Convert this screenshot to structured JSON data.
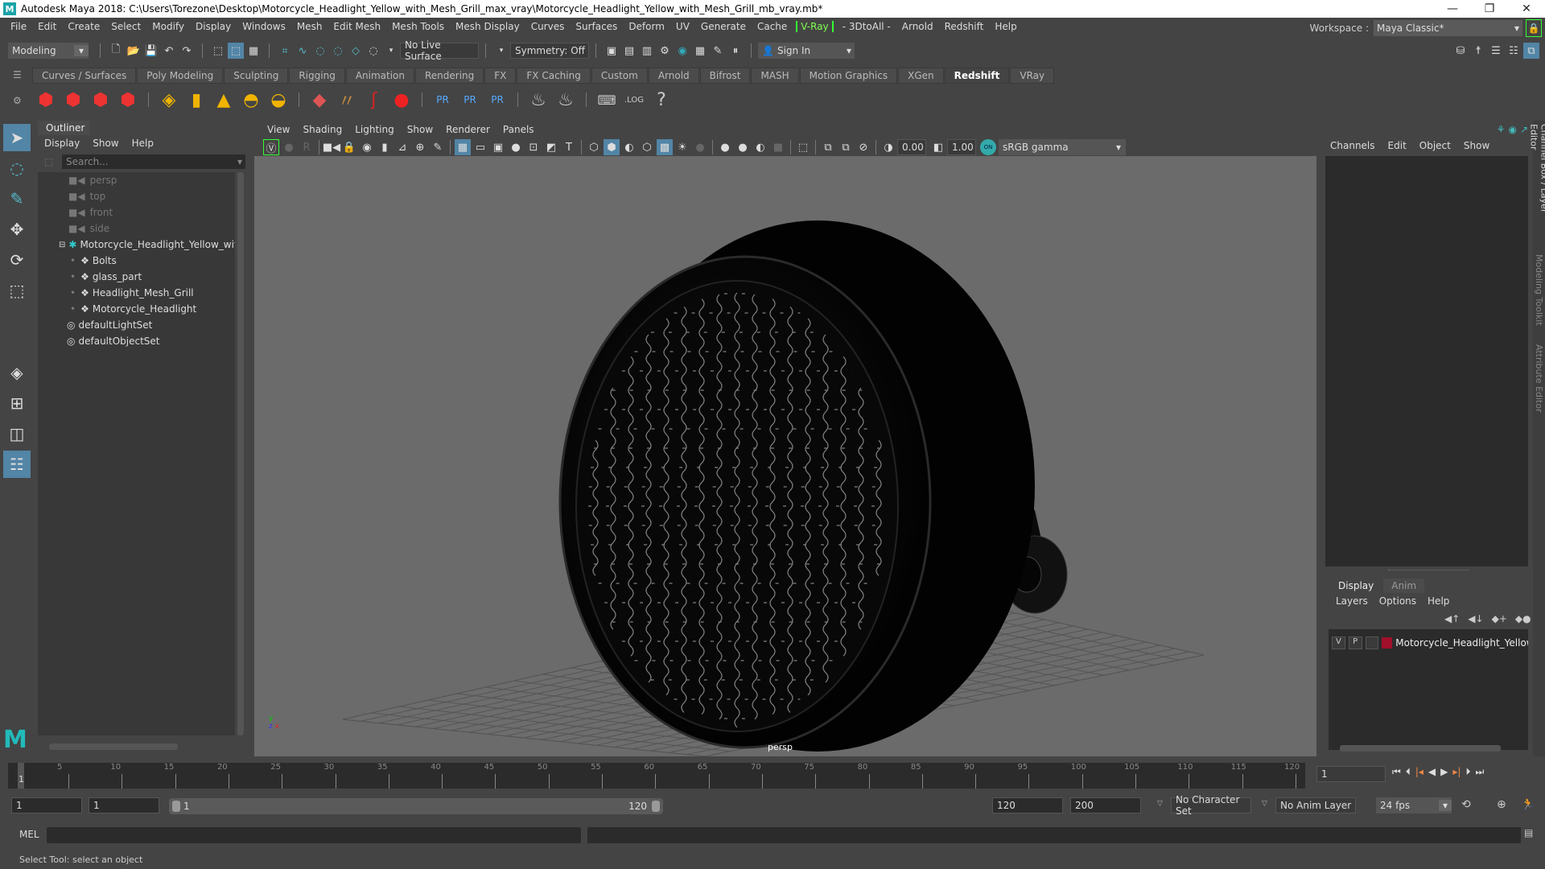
{
  "titlebar": {
    "title": "Autodesk Maya 2018: C:\\Users\\Torezone\\Desktop\\Motorcycle_Headlight_Yellow_with_Mesh_Grill_max_vray\\Motorcycle_Headlight_Yellow_with_Mesh_Grill_mb_vray.mb*",
    "logo": "M",
    "minimize": "—",
    "restore": "❐",
    "close": "✕"
  },
  "menubar": {
    "items": [
      "File",
      "Edit",
      "Create",
      "Select",
      "Modify",
      "Display",
      "Windows",
      "Mesh",
      "Edit Mesh",
      "Mesh Tools",
      "Mesh Display",
      "Curves",
      "Surfaces",
      "Deform",
      "UV",
      "Generate",
      "Cache"
    ],
    "vray": "V-Ray",
    "extra": [
      "- 3DtoAll -",
      "Arnold",
      "Redshift",
      "Help"
    ]
  },
  "workspace": {
    "label": "Workspace :",
    "value": "Maya Classic*"
  },
  "statusline": {
    "mode": "Modeling",
    "live_surface": "No Live Surface",
    "symmetry": "Symmetry: Off",
    "sign_in": "Sign In"
  },
  "shelf": {
    "tabs": [
      "Curves / Surfaces",
      "Poly Modeling",
      "Sculpting",
      "Rigging",
      "Animation",
      "Rendering",
      "FX",
      "FX Caching",
      "Custom",
      "Arnold",
      "Bifrost",
      "MASH",
      "Motion Graphics",
      "XGen",
      "Redshift",
      "VRay"
    ],
    "active_tab": "Redshift",
    "icons": {
      "rv": "RV",
      "ipr": "IPR",
      "pr": "PR",
      "log": ".LOG",
      "help": "?"
    }
  },
  "outliner": {
    "title": "Outliner",
    "menu": [
      "Display",
      "Show",
      "Help"
    ],
    "search_placeholder": "Search...",
    "items": [
      {
        "label": "persp",
        "type": "camera",
        "dim": true
      },
      {
        "label": "top",
        "type": "camera",
        "dim": true
      },
      {
        "label": "front",
        "type": "camera",
        "dim": true
      },
      {
        "label": "side",
        "type": "camera",
        "dim": true
      },
      {
        "label": "Motorcycle_Headlight_Yellow_with_M",
        "type": "group",
        "expanded": true
      },
      {
        "label": "Bolts",
        "type": "mesh",
        "child": true
      },
      {
        "label": "glass_part",
        "type": "mesh",
        "child": true
      },
      {
        "label": "Headlight_Mesh_Grill",
        "type": "mesh",
        "child": true
      },
      {
        "label": "Motorcycle_Headlight",
        "type": "mesh",
        "child": true
      },
      {
        "label": "defaultLightSet",
        "type": "set"
      },
      {
        "label": "defaultObjectSet",
        "type": "set"
      }
    ]
  },
  "viewport": {
    "menu": [
      "View",
      "Shading",
      "Lighting",
      "Show",
      "Renderer",
      "Panels"
    ],
    "exposure": "0.00",
    "gamma": "1.00",
    "color_mgmt": "ON",
    "color_space": "sRGB gamma",
    "camera_label": "persp",
    "axis": {
      "x": "x",
      "y": "y",
      "z": "z"
    }
  },
  "channelbox": {
    "menu": [
      "Channels",
      "Edit",
      "Object",
      "Show"
    ]
  },
  "layereditor": {
    "tabs": [
      "Display",
      "Anim"
    ],
    "active_tab": "Display",
    "menu": [
      "Layers",
      "Options",
      "Help"
    ],
    "layers": [
      {
        "v": "V",
        "p": "P",
        "name": "Motorcycle_Headlight_Yellow_",
        "color": "#a0102a"
      }
    ]
  },
  "sidetabs": [
    "Channel Box / Layer Editor",
    "Modeling Toolkit",
    "Attribute Editor"
  ],
  "timeline": {
    "ticks": [
      "5",
      "10",
      "15",
      "20",
      "25",
      "30",
      "35",
      "40",
      "45",
      "50",
      "55",
      "60",
      "65",
      "70",
      "75",
      "80",
      "85",
      "90",
      "95",
      "100",
      "105",
      "110",
      "115",
      "120"
    ],
    "current_frame_marker": "1",
    "current_frame": "1"
  },
  "range": {
    "start": "1",
    "anim_start": "1",
    "slider_start": "1",
    "slider_end": "120",
    "end": "120",
    "anim_end": "200",
    "character_set": "No Character Set",
    "anim_layer": "No Anim Layer",
    "fps": "24 fps"
  },
  "cmdline": {
    "label": "MEL"
  },
  "helpline": {
    "text": "Select Tool: select an object"
  }
}
